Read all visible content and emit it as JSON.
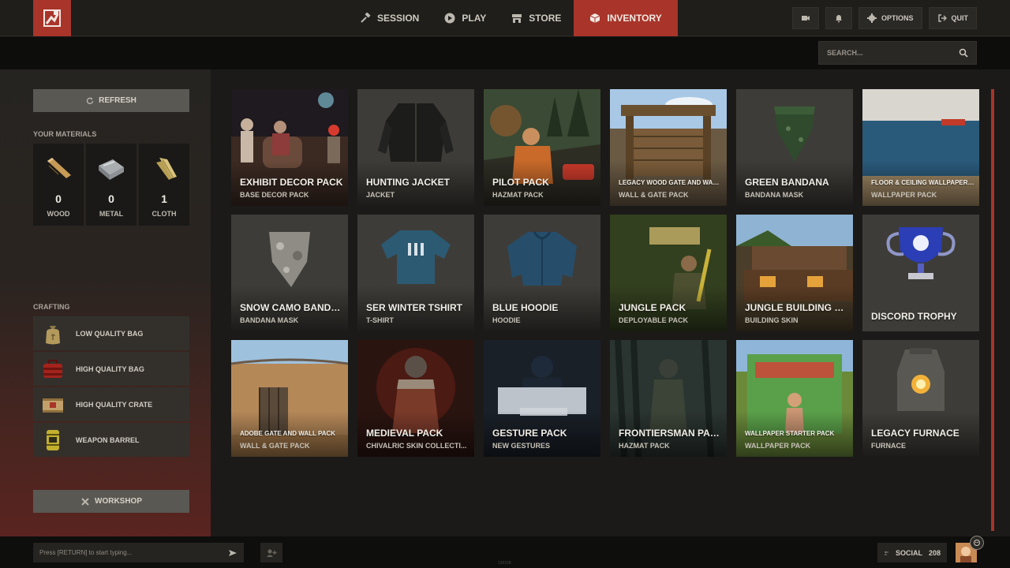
{
  "nav": {
    "items": [
      {
        "label": "SESSION",
        "icon": "hammer-icon"
      },
      {
        "label": "PLAY",
        "icon": "play-icon"
      },
      {
        "label": "STORE",
        "icon": "store-icon"
      },
      {
        "label": "INVENTORY",
        "icon": "box-icon",
        "active": true
      }
    ],
    "accent": "#a8342a"
  },
  "topright": {
    "options_label": "OPTIONS",
    "quit_label": "QUIT"
  },
  "search": {
    "placeholder": "SEARCH..."
  },
  "sidebar": {
    "refresh_label": "REFRESH",
    "materials_title": "YOUR MATERIALS",
    "materials": [
      {
        "name": "WOOD",
        "count": "0"
      },
      {
        "name": "METAL",
        "count": "0"
      },
      {
        "name": "CLOTH",
        "count": "1"
      }
    ],
    "crafting_title": "CRAFTING",
    "crafting": [
      {
        "label": "LOW QUALITY BAG"
      },
      {
        "label": "HIGH QUALITY BAG"
      },
      {
        "label": "HIGH QUALITY CRATE"
      },
      {
        "label": "WEAPON BARREL"
      }
    ],
    "workshop_label": "WORKSHOP"
  },
  "items": [
    {
      "name": "EXHIBIT DECOR PACK",
      "type": "BASE DECOR PACK"
    },
    {
      "name": "HUNTING JACKET",
      "type": "JACKET"
    },
    {
      "name": "PILOT PACK",
      "type": "HAZMAT PACK"
    },
    {
      "name": "LEGACY WOOD GATE AND WALL P...",
      "type": "WALL & GATE PACK"
    },
    {
      "name": "GREEN BANDANA",
      "type": "BANDANA MASK"
    },
    {
      "name": "FLOOR & CEILING WALLPAPER PA...",
      "type": "WALLPAPER PACK"
    },
    {
      "name": "SNOW CAMO BANDANA",
      "type": "BANDANA MASK"
    },
    {
      "name": "SER WINTER TSHIRT",
      "type": "T-SHIRT"
    },
    {
      "name": "BLUE HOODIE",
      "type": "HOODIE"
    },
    {
      "name": "JUNGLE PACK",
      "type": "DEPLOYABLE PACK"
    },
    {
      "name": "JUNGLE BUILDING SKIN",
      "type": "BUILDING SKIN"
    },
    {
      "name": "DISCORD TROPHY",
      "type": ""
    },
    {
      "name": "ADOBE GATE AND WALL PACK",
      "type": "WALL & GATE PACK"
    },
    {
      "name": "MEDIEVAL PACK",
      "type": "CHIVALRIC SKIN COLLECTI..."
    },
    {
      "name": "GESTURE PACK",
      "type": "NEW GESTURES"
    },
    {
      "name": "FRONTIERSMAN PACK",
      "type": "HAZMAT PACK"
    },
    {
      "name": "WALLPAPER STARTER PACK",
      "type": "WALLPAPER PACK"
    },
    {
      "name": "LEGACY FURNACE",
      "type": "FURNACE"
    }
  ],
  "bottom": {
    "chat_placeholder": "Press [RETURN] to start typing...",
    "social_label": "SOCIAL",
    "social_count": "208",
    "version": "130158"
  }
}
